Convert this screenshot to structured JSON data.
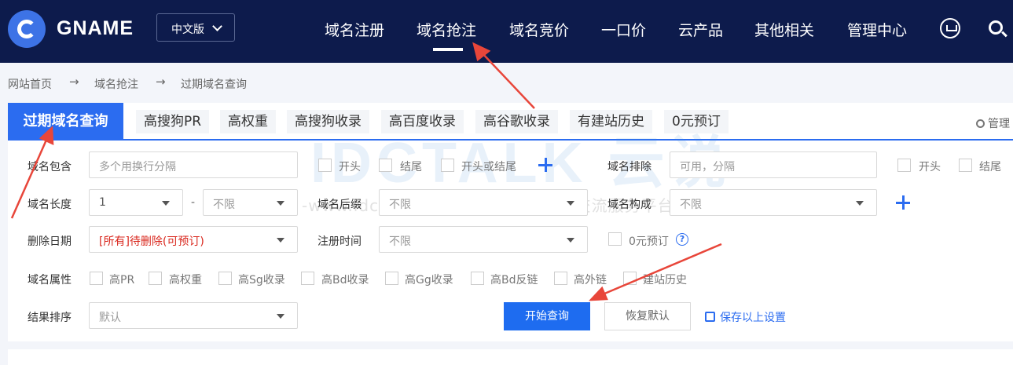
{
  "header": {
    "brand": "GNAME",
    "language": "中文版",
    "nav": [
      "域名注册",
      "域名抢注",
      "域名竞价",
      "一口价",
      "云产品",
      "其他相关",
      "管理中心"
    ],
    "icons": [
      "cart-icon",
      "search-icon"
    ]
  },
  "breadcrumb": [
    "网站首页",
    "域名抢注",
    "过期域名查询"
  ],
  "breadcrumb_sep": "→",
  "tabs": {
    "active": "过期域名查询",
    "items": [
      "高搜狗PR",
      "高权重",
      "高搜狗收录",
      "高百度收录",
      "高谷歌收录",
      "有建站历史",
      "0元预订"
    ],
    "manage": "管理"
  },
  "form": {
    "contains": {
      "label": "域名包含",
      "placeholder": "多个用换行分隔",
      "options": [
        "开头",
        "结尾",
        "开头或结尾"
      ]
    },
    "exclude": {
      "label": "域名排除",
      "placeholder": "可用，分隔",
      "options": [
        "开头",
        "结尾"
      ]
    },
    "length": {
      "label": "域名长度",
      "min": "1",
      "dash": "-",
      "max": "不限"
    },
    "suffix": {
      "label": "域名后缀",
      "value": "不限"
    },
    "composition": {
      "label": "域名构成",
      "value": "不限"
    },
    "delete_date": {
      "label": "删除日期",
      "value": "[所有]待删除(可预订)"
    },
    "reg_time": {
      "label": "注册时间",
      "value": "不限"
    },
    "zero_reserve": {
      "label": "0元预订",
      "help": "?"
    },
    "attributes": {
      "label": "域名属性",
      "options": [
        "高PR",
        "高权重",
        "高Sg收录",
        "高Bd收录",
        "高Gg收录",
        "高Bd反链",
        "高外链",
        "建站历史"
      ]
    },
    "sort": {
      "label": "结果排序",
      "value": "默认"
    },
    "search_button": "开始查询",
    "reset_button": "恢复默认",
    "save_link": "保存以上设置"
  },
  "watermark": {
    "brand": "IDCTALK 云说",
    "line": "-www.idctalk.com-国内专业云计算交流服务平台-"
  },
  "colors": {
    "header_bg": "#0d1b4c",
    "accent": "#2b6cf0",
    "annotation_arrow": "#e8463a",
    "delete_date_text": "#d9261c"
  }
}
